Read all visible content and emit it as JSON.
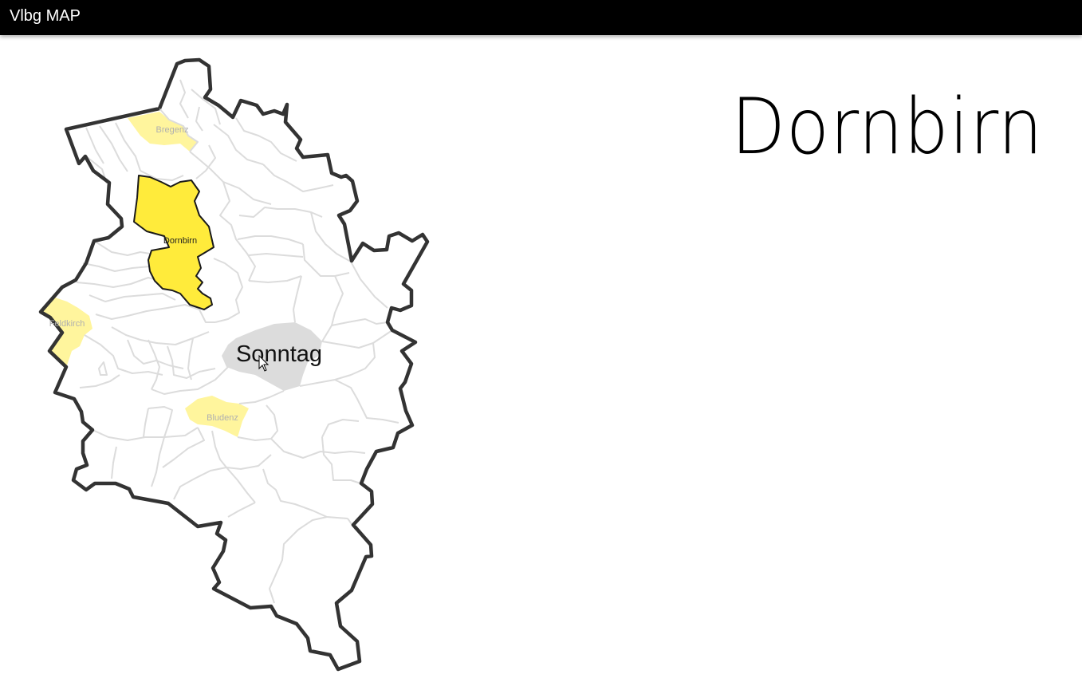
{
  "app": {
    "title": "Vlbg MAP"
  },
  "selection": {
    "selected_name": "Dornbirn",
    "hover_name": "Sonntag"
  },
  "map": {
    "labels": {
      "bregenz": "Bregenz",
      "dornbirn": "Dornbirn",
      "feldkirch": "Feldkirch",
      "bludenz": "Bludenz"
    },
    "colors": {
      "selected_fill": "#ffeb3b",
      "highlight_fill": "#fff59d",
      "hover_fill": "#dcdcdc",
      "border": "#333333",
      "municipality_lines": "#dcdcdc"
    }
  }
}
